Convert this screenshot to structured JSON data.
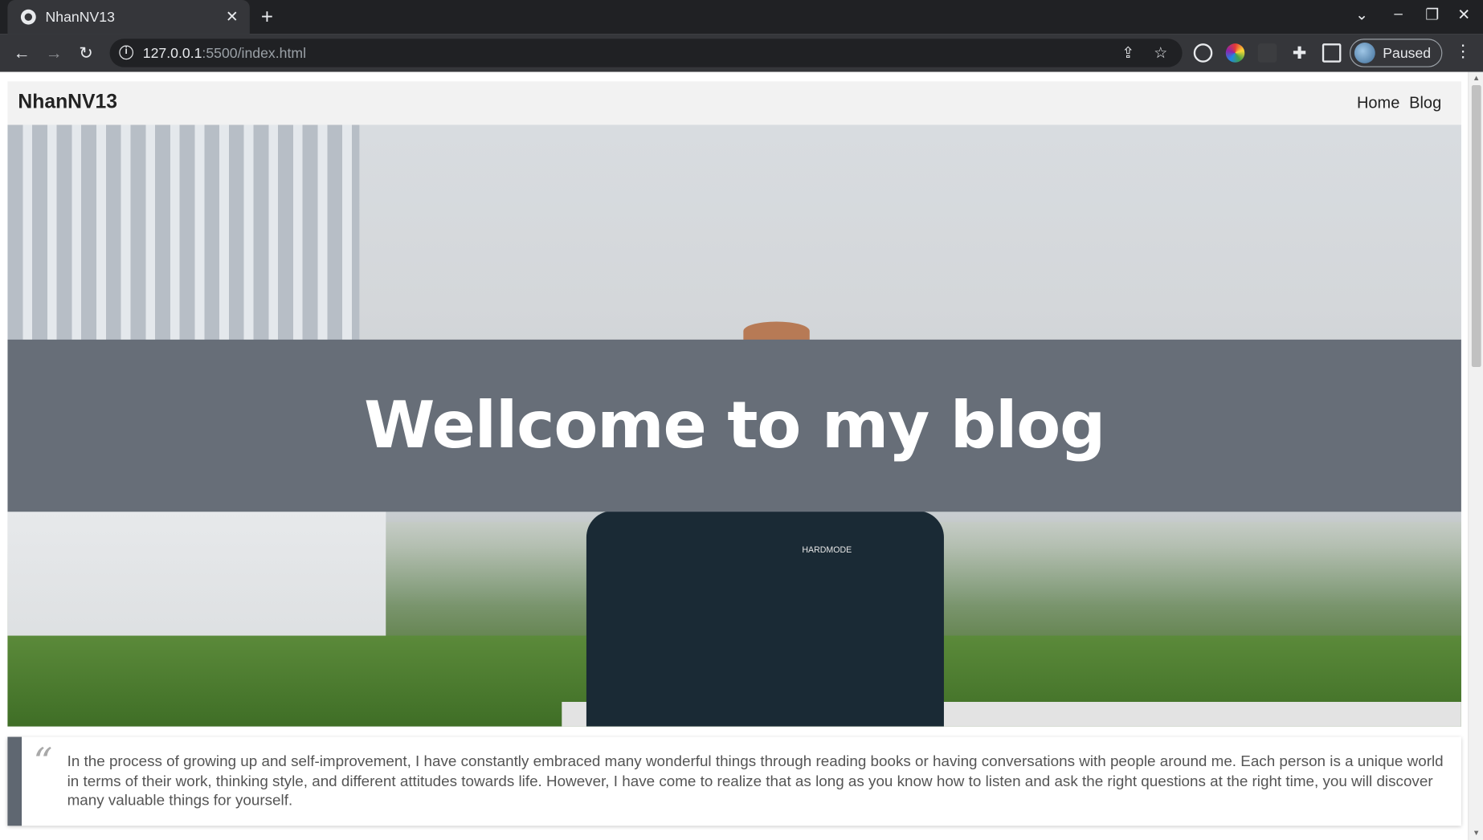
{
  "browser": {
    "tab_title": "NhanNV13",
    "url_host": "127.0.0.1",
    "url_rest": ":5500/index.html",
    "profile_label": "Paused"
  },
  "nav": {
    "brand": "NhanNV13",
    "links": [
      "Home",
      "Blog"
    ]
  },
  "hero": {
    "title": "Wellcome to my blog",
    "shirt_logo_text": "HARDMODE"
  },
  "quote": {
    "mark": "“",
    "text": "In the process of growing up and self-improvement, I have constantly embraced many wonderful things through reading books or having conversations with people around me. Each person is a unique world in terms of their work, thinking style, and different attitudes towards life. However, I have come to realize that as long as you know how to listen and ask the right questions at the right time, you will discover many valuable things for yourself."
  },
  "icons": {
    "tab_close": "close-icon",
    "new_tab": "plus-icon",
    "back": "arrow-left-icon",
    "forward": "arrow-right-icon",
    "reload": "reload-icon",
    "share": "share-icon",
    "bookmark": "star-icon",
    "extensions": "puzzle-icon"
  }
}
